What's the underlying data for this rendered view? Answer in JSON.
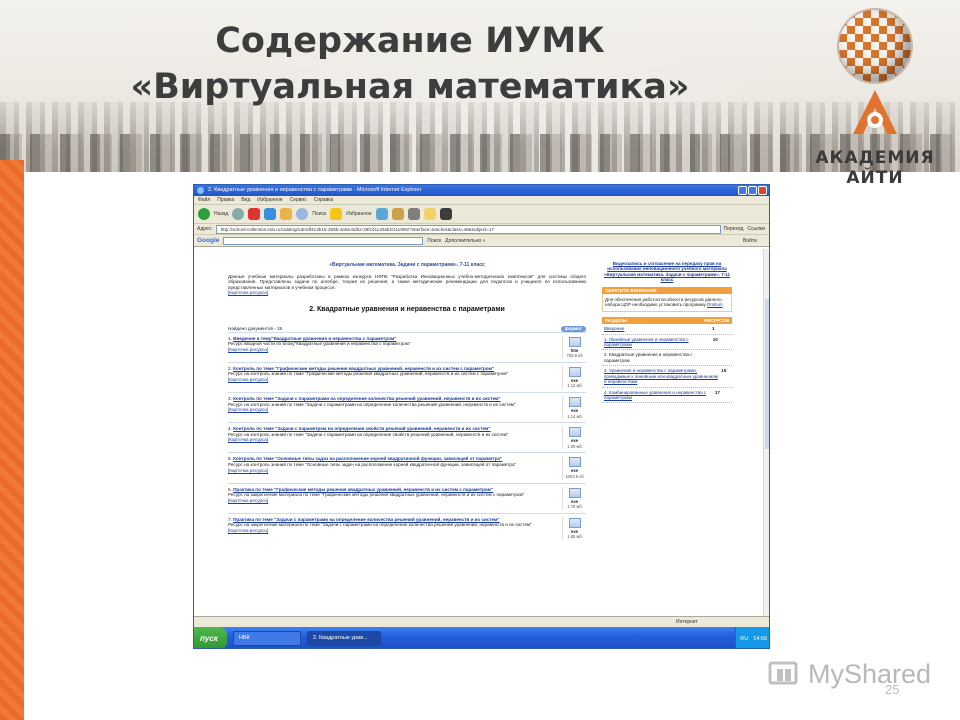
{
  "slide": {
    "title_line1": "Содержание ИУМК",
    "title_line2": "«Виртуальная математика»",
    "logo_text": "АКАДЕМИЯ  АЙТИ",
    "page_number": "25",
    "watermark_text": "MyShared",
    "accent_color": "#e86b2a"
  },
  "ie": {
    "window_title": "2. Квадратные уравнения и неравенства с параметрами - Microsoft Internet Explorer",
    "menu": [
      "Файл",
      "Правка",
      "Вид",
      "Избранное",
      "Сервис",
      "Справка"
    ],
    "toolbar": {
      "back": "Назад",
      "search": "Поиск",
      "favorites": "Избранное"
    },
    "address_url": "http://school-collection.edu.ru/catalog/rubr/df413b15-266b-4a0a-bdb2-28fc41140ab2/111905/?interface=teacher&class=49&subject=17",
    "go_label": "Переход",
    "links_label": "Ссылки",
    "google": {
      "logo": "Google",
      "search_button": "Поиск",
      "more": "Дополнительно »",
      "settings": "Войти"
    },
    "status_zone": "Интернет",
    "taskbar": {
      "start": "пуск",
      "tasks": [
        "НВК",
        "2. Квадратные урав..."
      ],
      "lang": "RU",
      "clock": "14:56"
    }
  },
  "page": {
    "subtitle": "«Виртуальная математика. Задачи с параметрами». 7-11 класс",
    "intro": "Данные учебные материалы разработаны в рамках конкурса НФПК \"Разработка Инновационных учебно-методических комплексов\" для системы общего образования. Представлены задачи по алгебре, теория их решения, а также методические рекомендации для педагогов и учащихся по использованию представленных материалов в учебном процессе.",
    "intro_link": "[Карточка ресурса]",
    "section_title": "2. Квадратные уравнения и неравенства с параметрами",
    "found_label": "Найдено документов - 15",
    "format_badge": "формат",
    "documents": [
      {
        "num": "1.",
        "title": "Введение в тему\"Квадратные уравнения и неравенства с параметром\"",
        "desc": "Ресурс вводной части по блоку\"Квадратные уравнения и неравенства с параметром\"",
        "card": "[Карточка ресурса]",
        "fmt": "htm",
        "size": "763.9 кб"
      },
      {
        "num": "2.",
        "title": "Контроль по теме \"Графические методы решения квадратных уравнений, неравенств и их систем с параметром\"",
        "desc": "Ресурс на контроль знаний по теме \"Графические методы решения квадратных уравнений, неравенств и их систем с параметром\"",
        "card": "[Карточка ресурса]",
        "fmt": "exe",
        "size": "1.13 мб"
      },
      {
        "num": "3.",
        "title": "Контроль по теме \"Задачи с параметрами на определение количества решений уравнений, неравенств и их систем\"",
        "desc": "Ресурс на контроль знаний по теме \"Задачи с параметрами на определение количества решений уравнений, неравенств и их систем\"",
        "card": "[Карточка ресурса]",
        "fmt": "exe",
        "size": "1.14 мб"
      },
      {
        "num": "4.",
        "title": "Контроль по теме \"Задачи с параметром на определение свойств решений уравнений, неравенств и их систем\"",
        "desc": "Ресурс на контроль знаний по теме \"Задачи с параметрами на определение свойств решений уравнений, неравенств и их систем\"",
        "card": "[Карточка ресурса]",
        "fmt": "exe",
        "size": "1.09 мб"
      },
      {
        "num": "5.",
        "title": "Контроль по теме \"Основные типы задач на расположение корней квадратичной функции, зависящей от параметра\"",
        "desc": "Ресурс на контроль знаний по теме \"Основные типы задач на расположение корней квадратичной функции, зависящей от параметра\"",
        "card": "[Карточка ресурса]",
        "fmt": "exe",
        "size": "1002.5 кб"
      },
      {
        "num": "6.",
        "title": "Практика по теме \"Графические методы решения квадратных уравнений, неравенств и их систем с параметром\"",
        "desc": "Ресурс на закрепление материала по теме \"Графические методы решения квадратных уравнений, неравенств и их систем с параметром\"",
        "card": "[Карточка ресурса]",
        "fmt": "exe",
        "size": "1.75 мб"
      },
      {
        "num": "7.",
        "title": "Практика по теме \"Задачи с параметрами на определение количества решений уравнений, неравенств и их систем\"",
        "desc": "Ресурс на закрепление материала по теме \"Задачи с параметрами на определение количества решений уравнений, неравенств и их систем\"",
        "card": "[Карточка ресурса]",
        "fmt": "exe",
        "size": "1.85 мб"
      }
    ],
    "side": {
      "share_link": "Видеозапись и соглашение на передачу прав на использование инновационного учебного материала «Виртуальная математика. Задачи с параметрами». 7-11 класс",
      "attention_header": "ОБРАТИТЕ ВНИМАНИЕ",
      "attention_text": "Для обеспечения работоспособности ресурсов данного набора ЦОР необходимо установить программу",
      "attention_link": "Dmitum",
      "table_head_sections": "РАЗДЕЛЫ",
      "table_head_resources": "РЕСУРСОВ",
      "sections": [
        {
          "name": "Введение",
          "count": "1"
        },
        {
          "name": "1. Линейные уравнения и неравенства с параметрами",
          "count": "10"
        },
        {
          "name": "2. Квадратные уравнения и неравенства с параметром",
          "count": ""
        },
        {
          "name": "3. Уравнения и неравенства с параметрами, приводимые к линейным или квадратным уравнениям и неравенствам",
          "count": "15"
        },
        {
          "name": "4. Комбинированные уравнения и неравенства с параметрами",
          "count": "17"
        }
      ]
    }
  }
}
